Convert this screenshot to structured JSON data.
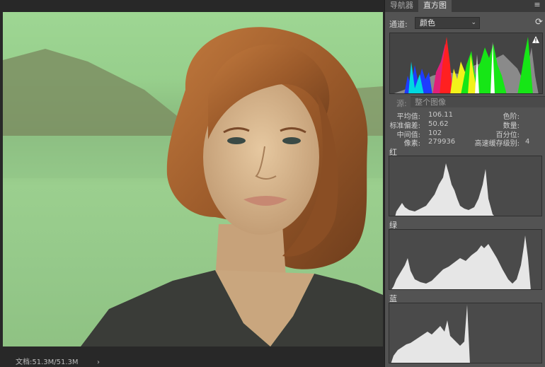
{
  "tabs": [
    {
      "label": "导航器",
      "active": false
    },
    {
      "label": "直方图",
      "active": true
    }
  ],
  "panel_menu_icon": "panel-menu-icon",
  "channel": {
    "label": "通道:",
    "value": "颜色"
  },
  "refresh_icon": "refresh-icon",
  "warning_icon": "warning-triangle-icon",
  "source": {
    "label": "源:",
    "value": "整个图像"
  },
  "stats": {
    "mean_label": "平均值:",
    "mean": "106.11",
    "stddev_label": "标准偏差:",
    "stddev": "50.62",
    "median_label": "中间值:",
    "median": "102",
    "pixels_label": "像素:",
    "pixels": "279936",
    "level_label": "色阶:",
    "level": "",
    "count_label": "数量:",
    "count": "",
    "percentile_label": "百分位:",
    "percentile": "",
    "cache_label": "高速缓存级别:",
    "cache": "4"
  },
  "channels": [
    {
      "name": "红",
      "color": "#e8e8e8"
    },
    {
      "name": "绿",
      "color": "#e8e8e8"
    },
    {
      "name": "蓝",
      "color": "#e8e8e8"
    }
  ],
  "status": {
    "doc": "文档:51.3M/51.3M",
    "arrow": "›"
  },
  "colors": {
    "panel_bg": "#535353",
    "hist_fill": "#e6e6e6",
    "photo_tint": "#9ed693"
  }
}
